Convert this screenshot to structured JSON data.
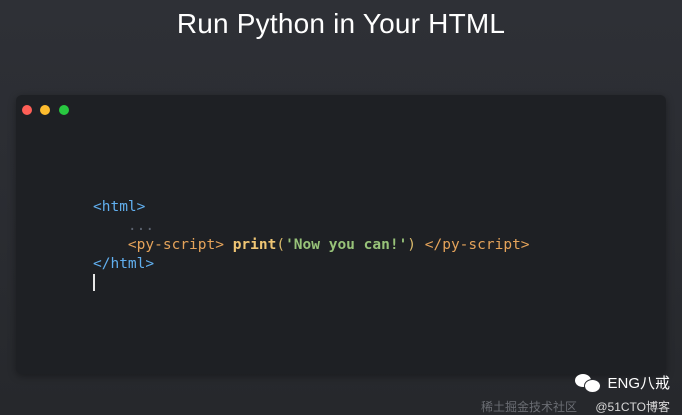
{
  "page": {
    "title": "Run Python in Your HTML"
  },
  "editor": {
    "code": {
      "line1": {
        "open_html": "<html>"
      },
      "line2": {
        "ellipsis": "..."
      },
      "line3": {
        "open_py": "<py-script>",
        "func": "print",
        "open_paren": "(",
        "string": "'Now you can!'",
        "close_paren": ")",
        "close_py": "</py-script>"
      },
      "line4": {
        "close_html": "</html>"
      }
    },
    "colors": {
      "window_bg": "#1e2024",
      "close": "#ff5f57",
      "minimize": "#febc2e",
      "maximize": "#28c840",
      "html_tag": "#61afef",
      "py_tag": "#e5a35a",
      "function": "#f0c674",
      "string": "#98c379"
    }
  },
  "watermark": {
    "main": "ENG八戒",
    "sub": "@51CTO博客",
    "faint": "稀土掘金技术社区"
  }
}
